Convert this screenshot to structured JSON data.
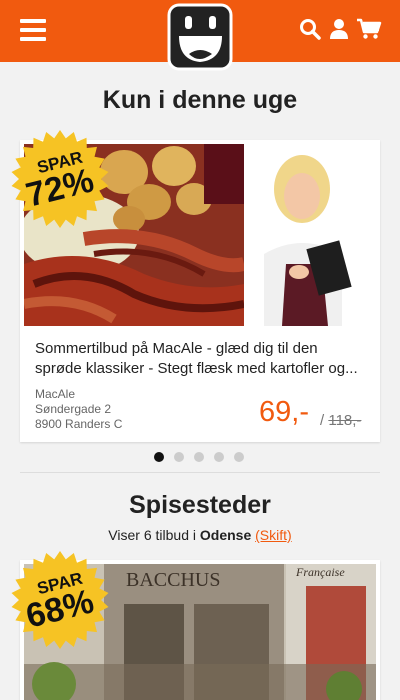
{
  "header": {
    "menu_icon": "hamburger-menu-icon",
    "logo_icon": "smiley-logo-icon",
    "search_icon": "search-icon",
    "user_icon": "user-icon",
    "cart_icon": "cart-icon",
    "accent_color": "#f15a0f"
  },
  "featured": {
    "title": "Kun i denne uge",
    "deal": {
      "badge_top": "SPAR",
      "badge_value": "72%",
      "description_line1": "Sommertilbud på MacAle - glæd dig til den",
      "description_line2": "sprøde klassiker - Stegt flæsk med kartofler og...",
      "merchant_name": "MacAle",
      "merchant_street": "Søndergade 2",
      "merchant_city": "8900 Randers C",
      "price": "69,-",
      "old_price_sep": "/",
      "old_price": "118,-"
    },
    "dots_total": 5,
    "dots_active": 1
  },
  "restaurants": {
    "title": "Spisesteder",
    "offers_prefix": "Viser 6 tilbud i ",
    "city": "Odense",
    "change_label": "(Skift)",
    "deal": {
      "badge_top": "SPAR",
      "badge_value": "68%",
      "sign_text": "BACCHUS",
      "sign_text2": "Française"
    }
  }
}
